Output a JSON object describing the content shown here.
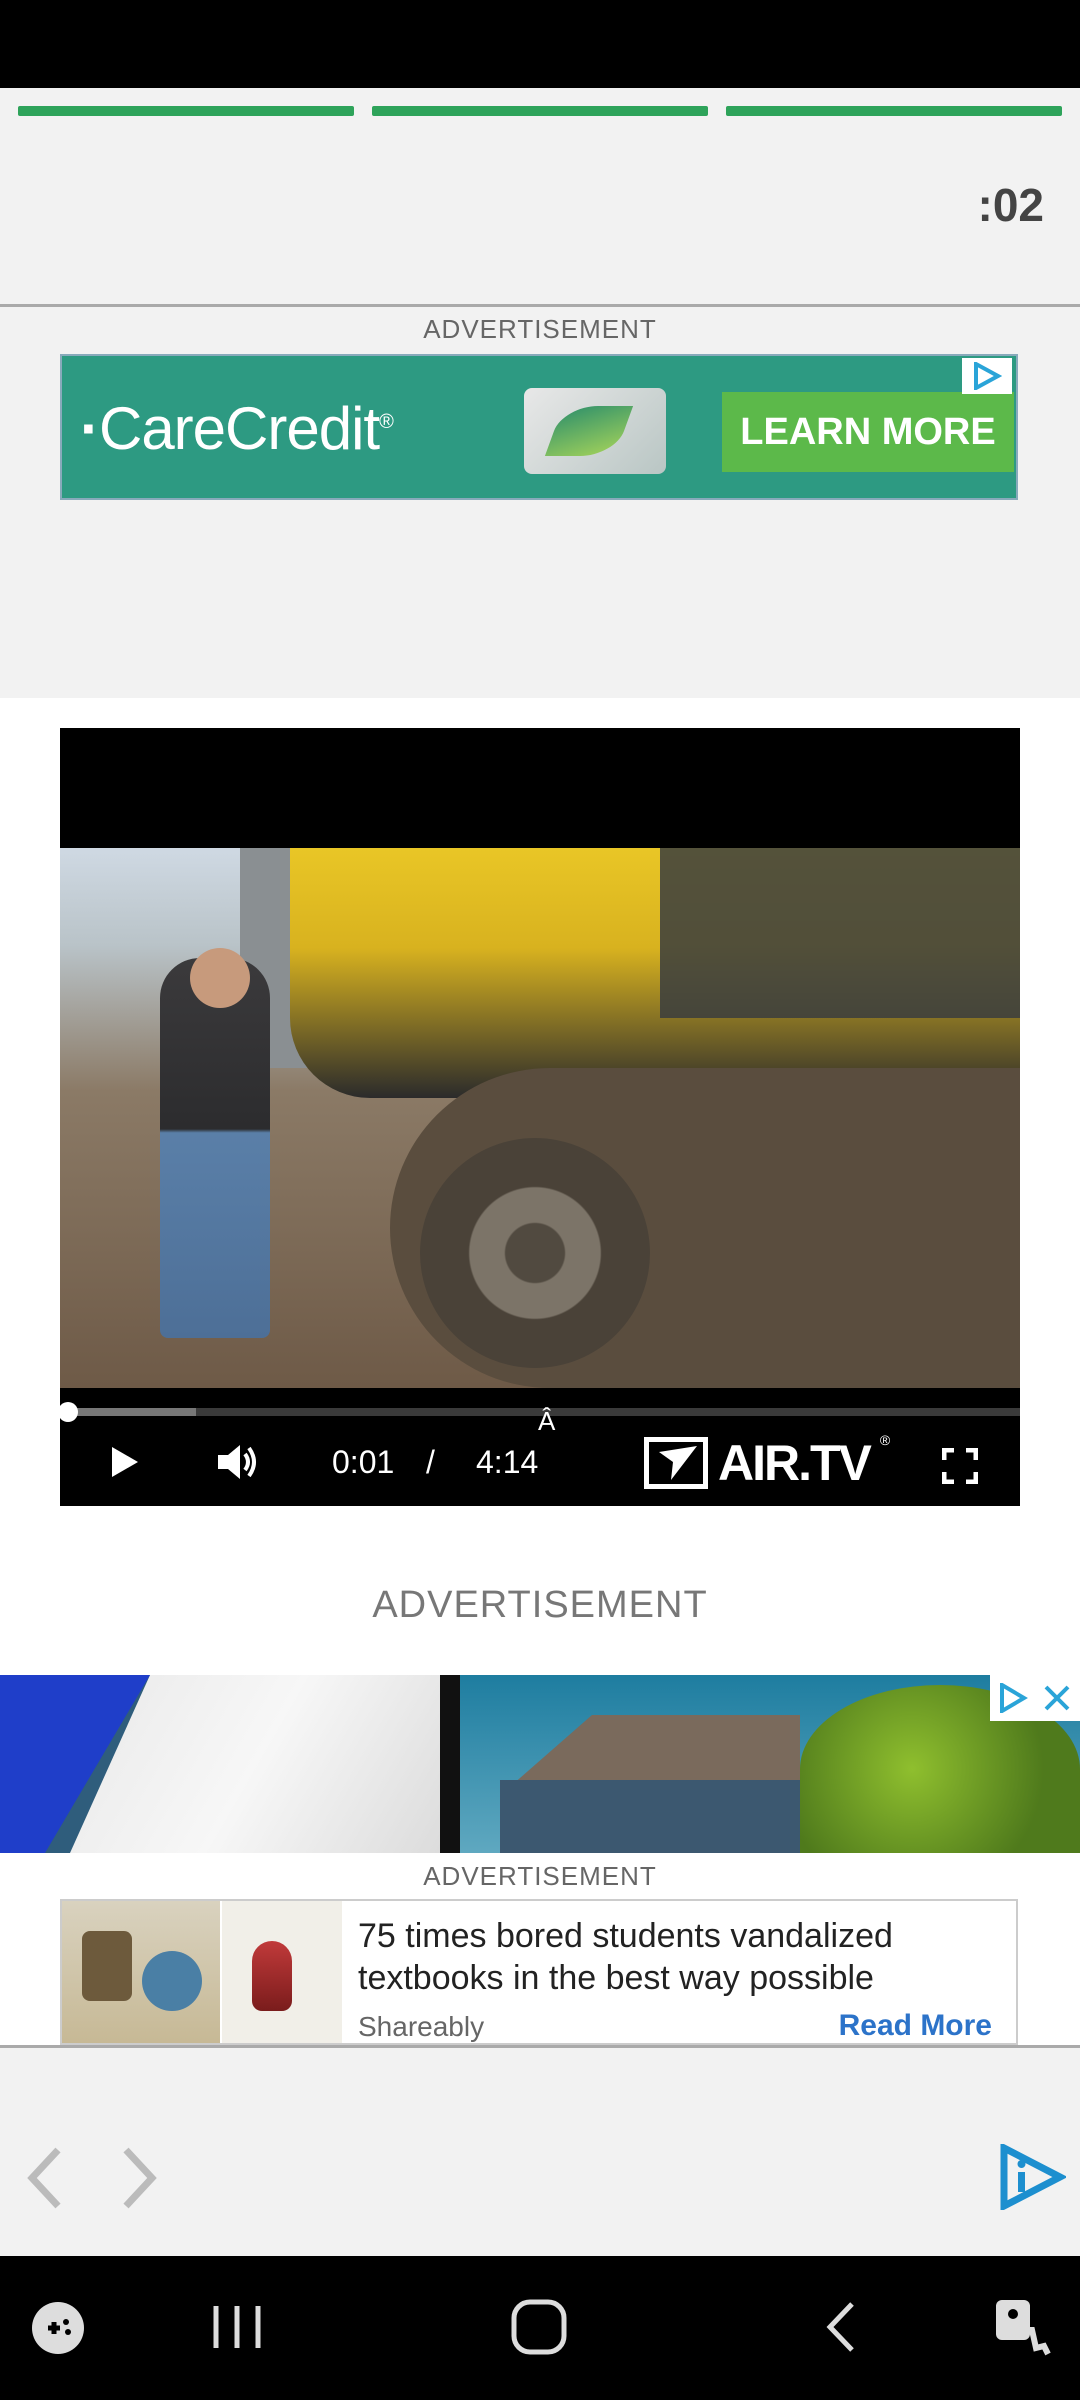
{
  "story": {
    "progress_segments": 3,
    "progress_color": "#2ea35a",
    "countdown": ":02"
  },
  "ads": {
    "label": "ADVERTISEMENT",
    "label_large": "ADVERTISEMENT",
    "carecredit": {
      "brand": "CareCredit",
      "cta": "LEARN MORE",
      "adchoices_icon": "adchoices-icon"
    },
    "native": {
      "headline": "75 times bored students vandalized textbooks in the best way possible",
      "source": "Shareably",
      "cta": "Read More"
    }
  },
  "video": {
    "current_time": "0:01",
    "separator": "/",
    "duration": "4:14",
    "stray_char": "Â",
    "brand": "AIR.TV",
    "registered": "®",
    "played_fraction": 0.0,
    "buffered_fraction": 0.14
  },
  "bottom_nav": {
    "prev_icon": "chevron-left-icon",
    "next_icon": "chevron-right-icon",
    "logo_icon": "adchoices-logo-icon"
  },
  "system_nav": {
    "game_icon": "game-launcher-icon",
    "recents_icon": "recents-icon",
    "home_icon": "home-icon",
    "back_icon": "back-icon",
    "accessibility_icon": "accessibility-icon"
  }
}
